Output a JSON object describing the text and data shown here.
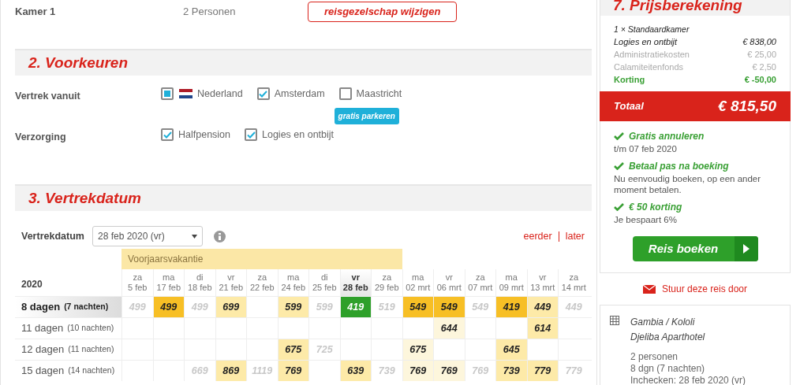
{
  "room": {
    "label": "Kamer 1",
    "persons": "2 Personen",
    "button": "reisgezelschap wijzigen"
  },
  "preferences": {
    "title": "2. Voorkeuren",
    "groups": [
      {
        "label": "Vertrek vanuit",
        "options": [
          {
            "label": "Nederland",
            "checked": true,
            "kind": "country"
          },
          {
            "label": "Amsterdam",
            "checked": true,
            "kind": "plain"
          },
          {
            "label": "Maastricht",
            "checked": false,
            "kind": "plain",
            "badge": "gratis parkeren"
          }
        ]
      },
      {
        "label": "Verzorging",
        "options": [
          {
            "label": "Halfpension",
            "checked": true,
            "kind": "plain"
          },
          {
            "label": "Logies en ontbijt",
            "checked": true,
            "kind": "plain"
          }
        ]
      }
    ]
  },
  "departure": {
    "title": "3. Vertrekdatum",
    "label": "Vertrekdatum",
    "select": "28 feb 2020 (vr)",
    "earlier": "eerder",
    "later": "later",
    "holiday": "Voorjaarsvakantie",
    "year": "2020",
    "columns": [
      {
        "day": "za",
        "date": "5 feb",
        "selected": false
      },
      {
        "day": "ma",
        "date": "17 feb",
        "selected": false
      },
      {
        "day": "di",
        "date": "18 feb",
        "selected": false
      },
      {
        "day": "vr",
        "date": "21 feb",
        "selected": false
      },
      {
        "day": "za",
        "date": "22 feb",
        "selected": false
      },
      {
        "day": "ma",
        "date": "24 feb",
        "selected": false
      },
      {
        "day": "di",
        "date": "25 feb",
        "selected": false
      },
      {
        "day": "vr",
        "date": "28 feb",
        "selected": true
      },
      {
        "day": "za",
        "date": "29 feb",
        "selected": false
      },
      {
        "day": "ma",
        "date": "02 mrt",
        "selected": false
      },
      {
        "day": "vr",
        "date": "06 mrt",
        "selected": false
      },
      {
        "day": "za",
        "date": "07 mrt",
        "selected": false
      },
      {
        "day": "ma",
        "date": "09 mrt",
        "selected": false
      },
      {
        "day": "vr",
        "date": "13 mrt",
        "selected": false
      },
      {
        "day": "za",
        "date": "14 mrt",
        "selected": false
      }
    ],
    "rows": [
      {
        "label": "8 dagen",
        "nights": "(7 nachten)",
        "selected": true,
        "cells": [
          {
            "kind": "grey",
            "price": "499"
          },
          {
            "kind": "low",
            "price": "499"
          },
          {
            "kind": "grey",
            "price": "499"
          },
          {
            "kind": "normal",
            "price": "699"
          },
          {
            "kind": "empty"
          },
          {
            "kind": "normal",
            "price": "599"
          },
          {
            "kind": "grey",
            "price": "599"
          },
          {
            "kind": "selected",
            "price": "419"
          },
          {
            "kind": "grey",
            "price": "519"
          },
          {
            "kind": "low",
            "price": "549"
          },
          {
            "kind": "low",
            "price": "549"
          },
          {
            "kind": "grey",
            "price": "549"
          },
          {
            "kind": "low",
            "price": "419"
          },
          {
            "kind": "normal",
            "price": "449"
          },
          {
            "kind": "grey",
            "price": "449"
          }
        ]
      },
      {
        "label": "11 dagen",
        "nights": "(10 nachten)",
        "selected": false,
        "cells": [
          {
            "kind": "empty"
          },
          {
            "kind": "empty"
          },
          {
            "kind": "empty"
          },
          {
            "kind": "empty"
          },
          {
            "kind": "empty"
          },
          {
            "kind": "empty"
          },
          {
            "kind": "empty"
          },
          {
            "kind": "empty"
          },
          {
            "kind": "empty"
          },
          {
            "kind": "empty"
          },
          {
            "kind": "pale",
            "price": "644"
          },
          {
            "kind": "empty"
          },
          {
            "kind": "empty"
          },
          {
            "kind": "normal",
            "price": "614"
          },
          {
            "kind": "empty"
          }
        ]
      },
      {
        "label": "12 dagen",
        "nights": "(11 nachten)",
        "selected": false,
        "cells": [
          {
            "kind": "empty"
          },
          {
            "kind": "empty"
          },
          {
            "kind": "empty"
          },
          {
            "kind": "empty"
          },
          {
            "kind": "empty"
          },
          {
            "kind": "normal",
            "price": "675"
          },
          {
            "kind": "grey",
            "price": "725"
          },
          {
            "kind": "empty"
          },
          {
            "kind": "empty"
          },
          {
            "kind": "pale",
            "price": "675"
          },
          {
            "kind": "empty"
          },
          {
            "kind": "empty"
          },
          {
            "kind": "normal",
            "price": "645"
          },
          {
            "kind": "empty"
          },
          {
            "kind": "empty"
          }
        ]
      },
      {
        "label": "15 dagen",
        "nights": "(14 nachten)",
        "selected": false,
        "cells": [
          {
            "kind": "empty"
          },
          {
            "kind": "empty"
          },
          {
            "kind": "grey",
            "price": "669"
          },
          {
            "kind": "normal",
            "price": "869"
          },
          {
            "kind": "grey",
            "price": "1119"
          },
          {
            "kind": "normal",
            "price": "769"
          },
          {
            "kind": "empty"
          },
          {
            "kind": "normal",
            "price": "639"
          },
          {
            "kind": "grey",
            "price": "739"
          },
          {
            "kind": "pale",
            "price": "769"
          },
          {
            "kind": "pale",
            "price": "769"
          },
          {
            "kind": "grey",
            "price": "769"
          },
          {
            "kind": "normal",
            "price": "739"
          },
          {
            "kind": "normal",
            "price": "779"
          },
          {
            "kind": "grey",
            "price": "779"
          }
        ]
      }
    ]
  },
  "price": {
    "title": "7. Prijsberekening",
    "room": "1 × Standaardkamer",
    "lines": [
      {
        "kind": "main",
        "label": "Logies en ontbijt",
        "amount": "€ 838,00"
      },
      {
        "kind": "fee",
        "label": "Administratiekosten",
        "amount": "€ 25,00"
      },
      {
        "kind": "fee",
        "label": "Calamiteitenfonds",
        "amount": "€ 2,50"
      },
      {
        "kind": "discount",
        "label": "Korting",
        "amount": "€ -50,00"
      }
    ],
    "total_label": "Totaal",
    "total": "€ 815,50",
    "perks": [
      {
        "title": "Gratis annuleren",
        "text": "t/m 07 feb 2020"
      },
      {
        "title": "Betaal pas na boeking",
        "text": "Nu eenvoudig boeken, op een ander moment betalen."
      },
      {
        "title": "€ 50 korting",
        "text": "Je bespaart 6%"
      }
    ],
    "book": "Reis boeken",
    "share": "Stuur deze reis door"
  },
  "summary": {
    "destination": "Gambia / Kololi",
    "hotel": "Djeliba Aparthotel",
    "details": [
      "2 personen",
      "8 dgn (7 nachten)",
      "Inchecken: 28 feb 2020 (vr)"
    ]
  }
}
